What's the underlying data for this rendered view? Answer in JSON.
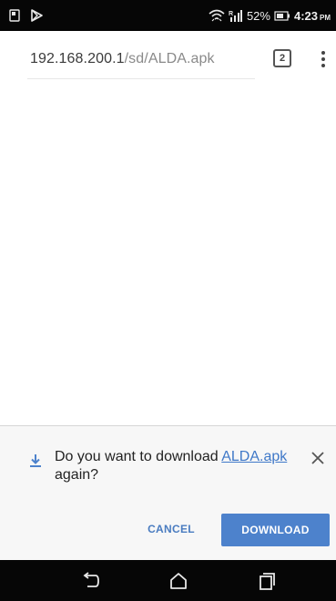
{
  "status_bar": {
    "battery_percent": "52%",
    "time": "4:23",
    "ampm": "PM",
    "icons": [
      "screenshot-icon",
      "playstore-icon",
      "wifi-icon",
      "roaming-signal-icon",
      "battery-icon"
    ]
  },
  "browser": {
    "url_host": "192.168.200.1",
    "url_path": "/sd/ALDA.apk",
    "tab_count": "2"
  },
  "infobar": {
    "message_prefix": "Do you want to download ",
    "file_name": "ALDA.apk",
    "message_suffix": " again?",
    "cancel_label": "CANCEL",
    "download_label": "DOWNLOAD"
  },
  "colors": {
    "accent": "#4d82cc",
    "link": "#3f78c8",
    "status_bar": "#060606"
  }
}
